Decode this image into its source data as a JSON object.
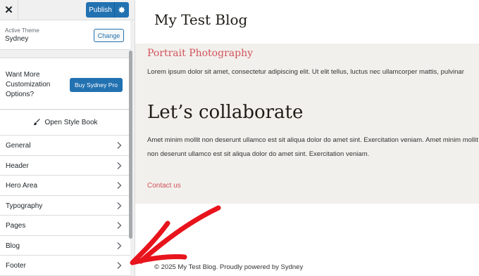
{
  "topbar": {
    "close_label": "✕",
    "publish_label": "Publish"
  },
  "theme": {
    "label": "Active Theme",
    "name": "Sydney",
    "change_label": "Change"
  },
  "promo": {
    "text": "Want More Customization Options?",
    "button_label": "Buy Sydney Pro"
  },
  "stylebook": {
    "label": "Open Style Book",
    "icon": "brush-icon"
  },
  "sections": [
    {
      "label": "General"
    },
    {
      "label": "Header"
    },
    {
      "label": "Hero Area"
    },
    {
      "label": "Typography"
    },
    {
      "label": "Pages"
    },
    {
      "label": "Blog"
    },
    {
      "label": "Footer"
    }
  ],
  "preview": {
    "site_title": "My Test Blog",
    "section_heading": "Portrait Photography",
    "lorem": "Lorem ipsum dolor sit amet, consectetur adipiscing elit. Ut elit tellus, luctus nec ullamcorper mattis, pulvinar",
    "collab_heading": "Let’s collaborate",
    "amet": "Amet minim mollit non deserunt ullamco est sit aliqua dolor do amet sint. Exercitation veniam. Amet minim mollit non deserunt ullamco est sit aliqua dolor do amet sint. Exercitation veniam.",
    "contact_link": "Contact us",
    "footer": "© 2025 My Test Blog. Proudly powered by Sydney"
  },
  "colors": {
    "accent": "#2271b1",
    "heading_red": "#d1525b",
    "annotation_red": "#e8141c",
    "preview_bg": "#f2f0ec"
  }
}
